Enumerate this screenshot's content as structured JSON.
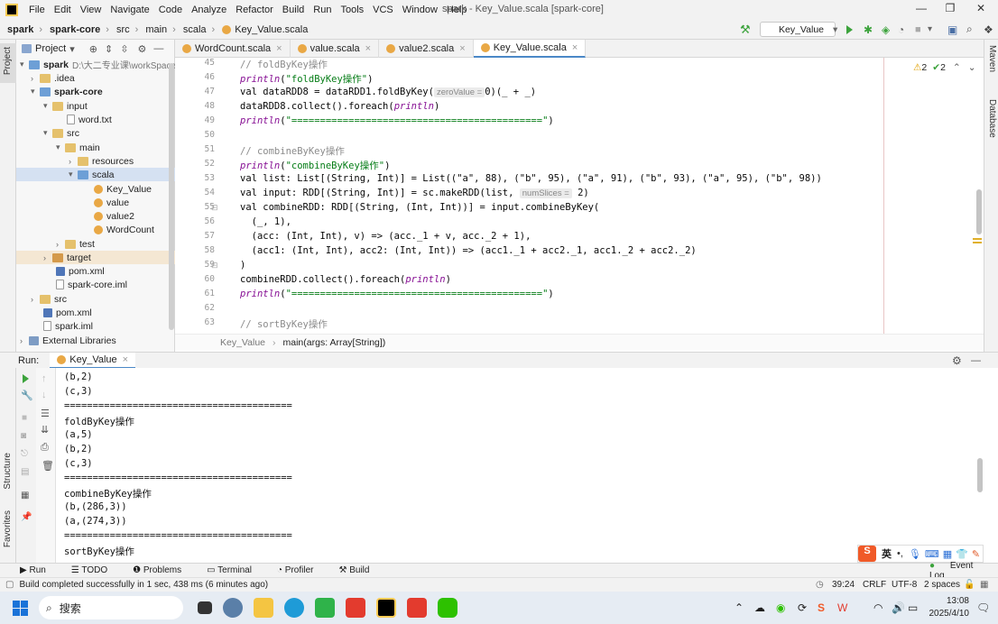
{
  "menu": [
    "File",
    "Edit",
    "View",
    "Navigate",
    "Code",
    "Analyze",
    "Refactor",
    "Build",
    "Run",
    "Tools",
    "VCS",
    "Window",
    "Help"
  ],
  "window_title": "spark - Key_Value.scala [spark-core]",
  "nav": {
    "crumbs": [
      "spark",
      "spark-core",
      "src",
      "main",
      "scala",
      "Key_Value.scala"
    ],
    "run_config": "Key_Value"
  },
  "project": {
    "header": "Project",
    "root": "spark",
    "root_path": "D:\\大二专业课\\workSpace",
    "items": [
      ".idea",
      "spark-core",
      "input",
      "word.txt",
      "src",
      "main",
      "resources",
      "scala",
      "Key_Value",
      "value",
      "value2",
      "WordCount",
      "test",
      "target",
      "pom.xml",
      "spark-core.iml",
      "src",
      "pom.xml",
      "spark.iml",
      "External Libraries"
    ]
  },
  "tabs": [
    "WordCount.scala",
    "value.scala",
    "value2.scala",
    "Key_Value.scala"
  ],
  "editor": {
    "line_numbers": [
      "45",
      "46",
      "47",
      "48",
      "49",
      "50",
      "51",
      "52",
      "53",
      "54",
      "55",
      "56",
      "57",
      "58",
      "59",
      "60",
      "61",
      "62",
      "63"
    ],
    "inspections": {
      "warnings": "2",
      "ok": "2"
    },
    "hints": {
      "zero_value": "zeroValue =",
      "num_slices": "numSlices ="
    },
    "code": {
      "l45": "// foldByKey操作",
      "l46_fn": "println",
      "l46_str": "\"foldByKey操作\"",
      "l47": "val dataRDD8 = dataRDD1.foldByKey(",
      "l47b": "0)(_ + _)",
      "l48_a": "dataRDD8.collect().foreach(",
      "l48_fn": "println",
      "l49_fn": "println",
      "l49_str": "\"============================================\"",
      "l51": "// combineByKey操作",
      "l52_fn": "println",
      "l52_str": "\"combineByKey操作\"",
      "l53": "val list: List[(String, Int)] = List((\"a\", 88), (\"b\", 95), (\"a\", 91), (\"b\", 93), (\"a\", 95), (\"b\", 98))",
      "l54": "val input: RDD[(String, Int)] = sc.makeRDD(list, ",
      "l54b": "2)",
      "l55": "val combineRDD: RDD[(String, (Int, Int))] = input.combineByKey(",
      "l56": "  (_, 1),",
      "l57": "  (acc: (Int, Int), v) => (acc._1 + v, acc._2 + 1),",
      "l58": "  (acc1: (Int, Int), acc2: (Int, Int)) => (acc1._1 + acc2._1, acc1._2 + acc2._2)",
      "l59": ")",
      "l60_a": "combineRDD.collect().foreach(",
      "l60_fn": "println",
      "l61_fn": "println",
      "l61_str": "\"============================================\"",
      "l63": "// sortByKey操作"
    },
    "breadcrumb": [
      "Key_Value",
      "main(args: Array[String])"
    ]
  },
  "run": {
    "label": "Run:",
    "tab": "Key_Value",
    "output": [
      "(b,2)",
      "(c,3)",
      "========================================",
      "foldByKey操作",
      "(a,5)",
      "(b,2)",
      "(c,3)",
      "========================================",
      "combineByKey操作",
      "(b,(286,3))",
      "(a,(274,3))",
      "========================================",
      "sortByKey操作"
    ]
  },
  "toolwindows": [
    "Run",
    "TODO",
    "Problems",
    "Terminal",
    "Profiler",
    "Build"
  ],
  "side_labels": {
    "project": "Project",
    "structure": "Structure",
    "favorites": "Favorites",
    "maven": "Maven",
    "database": "Database"
  },
  "event_log": "Event Log",
  "status": {
    "message": "Build completed successfully in 1 sec, 438 ms (6 minutes ago)",
    "position": "39:24",
    "line_sep": "CRLF",
    "encoding": "UTF-8",
    "indent": "2 spaces"
  },
  "taskbar": {
    "search": "搜索",
    "time": "13:08",
    "date": "2025/4/10",
    "ime": "英"
  }
}
